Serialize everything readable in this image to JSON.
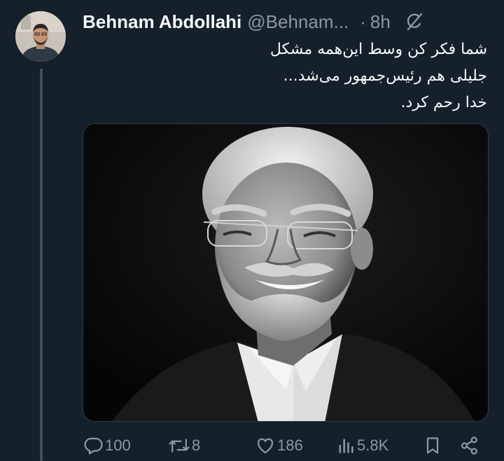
{
  "tweet": {
    "display_name": "Behnam Abdollahi",
    "handle": "@Behnam...",
    "separator": "·",
    "time": "8h",
    "text_lines": [
      "شما فکر کن وسط این‌همه مشکل",
      "جلیلی هم رئیس‌جمهور می‌شد...",
      "خدا رحم کرد."
    ],
    "media_alt": "black-and-white portrait photo"
  },
  "actions": {
    "replies": "100",
    "retweets": "8",
    "likes": "186",
    "views": "5.8K"
  },
  "icons": {
    "reply": "comment-icon",
    "retweet": "retweet-icon",
    "like": "heart-icon",
    "views": "bar-chart-icon",
    "bookmark": "bookmark-icon",
    "share": "share-icon",
    "grok": "grok-icon"
  },
  "colors": {
    "background": "#15202b",
    "text_primary": "#f7f9f9",
    "text_secondary": "#8b98a5",
    "thread_line": "#3e5163"
  }
}
